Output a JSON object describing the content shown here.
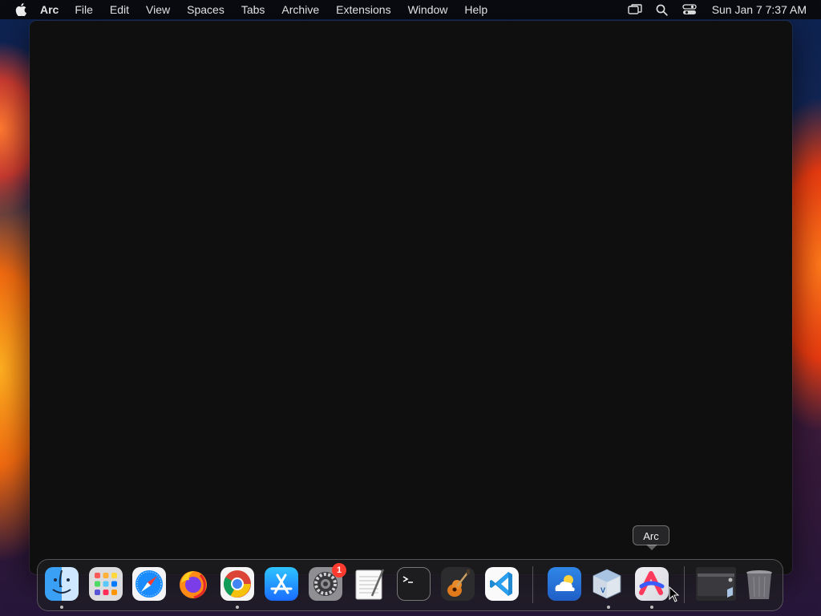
{
  "menubar": {
    "app_name": "Arc",
    "items": [
      "File",
      "Edit",
      "View",
      "Spaces",
      "Tabs",
      "Archive",
      "Extensions",
      "Window",
      "Help"
    ],
    "status_icons": [
      "screen-mirroring-icon",
      "search-icon",
      "control-center-icon"
    ],
    "clock": "Sun Jan 7  7:37 AM"
  },
  "window": {
    "app": "Arc"
  },
  "dock": {
    "apps": [
      {
        "name": "Finder",
        "icon": "finder-icon",
        "running": true
      },
      {
        "name": "Launchpad",
        "icon": "launchpad-icon",
        "running": false
      },
      {
        "name": "Safari",
        "icon": "safari-icon",
        "running": false
      },
      {
        "name": "Firefox",
        "icon": "firefox-icon",
        "running": false
      },
      {
        "name": "Google Chrome",
        "icon": "chrome-icon",
        "running": true
      },
      {
        "name": "App Store",
        "icon": "app-store-icon",
        "running": false
      },
      {
        "name": "System Settings",
        "icon": "system-settings-icon",
        "running": false,
        "badge": "1"
      },
      {
        "name": "TextEdit",
        "icon": "textedit-icon",
        "running": false
      },
      {
        "name": "Terminal",
        "icon": "terminal-icon",
        "running": false
      },
      {
        "name": "GarageBand",
        "icon": "garageband-icon",
        "running": false
      },
      {
        "name": "Visual Studio Code",
        "icon": "vscode-icon",
        "running": false
      },
      {
        "name": "Weather",
        "icon": "weather-icon",
        "running": false
      },
      {
        "name": "VirtualBox",
        "icon": "virtualbox-icon",
        "running": true
      },
      {
        "name": "Arc",
        "icon": "arc-icon",
        "running": true
      }
    ],
    "extras": [
      "virtualbox-window-icon",
      "trash-icon"
    ],
    "badge_text": "1",
    "tooltip": "Arc"
  },
  "colors": {
    "menubar_bg": "#0a0a0c",
    "window_bg": "#0f0f0f",
    "badge": "#ff3b30"
  }
}
